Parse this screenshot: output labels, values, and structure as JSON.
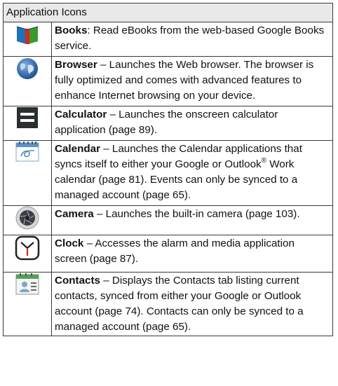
{
  "table_title": "Application Icons",
  "rows": [
    {
      "icon": "books-icon",
      "name": "Books",
      "separator": ": ",
      "text": "Read eBooks from the web-based Google Books service."
    },
    {
      "icon": "browser-globe-icon",
      "name": "Browser",
      "separator": " – ",
      "text": "Launches the Web browser. The browser is fully optimized and comes with advanced features to enhance Internet browsing on your device."
    },
    {
      "icon": "calculator-icon",
      "name": "Calculator",
      "separator": " – ",
      "text": "Launches the onscreen calculator application (page 89)."
    },
    {
      "icon": "calendar-icon",
      "name": "Calendar",
      "separator": " – ",
      "text_before": "Launches the Calendar applications that syncs itself to either your Google or Outlook",
      "superscript": "®",
      "text_after": " Work calendar (page 81). Events can only be synced to a managed account (page 65)."
    },
    {
      "icon": "camera-icon",
      "name": "Camera",
      "separator": " – ",
      "text": "Launches the built-in camera (page 103)."
    },
    {
      "icon": "clock-icon",
      "name": "Clock",
      "separator": " – ",
      "text": "Accesses the alarm and media application screen (page 87)."
    },
    {
      "icon": "contacts-icon",
      "name": "Contacts",
      "separator": " – ",
      "text": "Displays the Contacts tab listing current contacts, synced from either your Google or Outlook account (page 74). Contacts can only be synced to a managed account (page 65)."
    }
  ]
}
